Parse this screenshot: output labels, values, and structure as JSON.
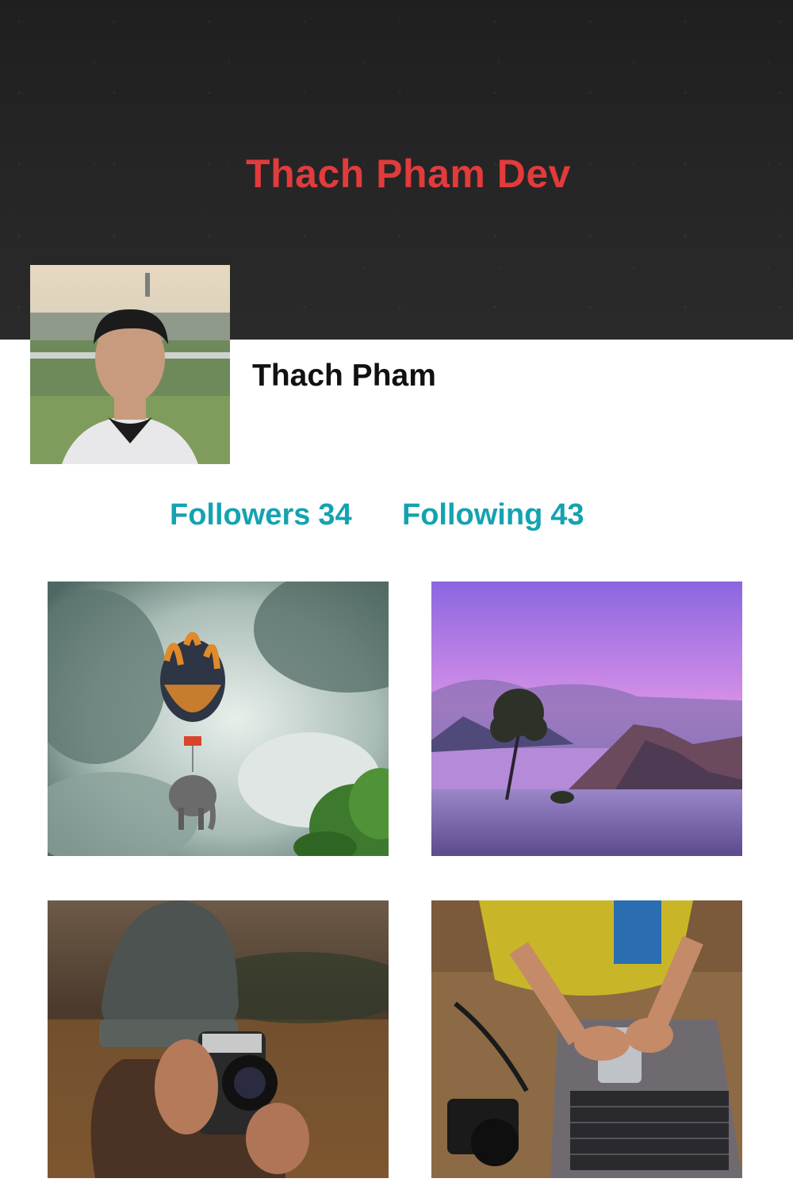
{
  "header": {
    "site_title": "Thach Pham Dev",
    "background_color": "#1f1f20",
    "title_color": "#e23b3b"
  },
  "profile": {
    "name": "Thach Pham",
    "avatar_icon": "person-photo"
  },
  "stats": {
    "followers_label": "Followers",
    "followers_count": "34",
    "following_label": "Following",
    "following_count": "43",
    "color": "#14a3b0"
  },
  "gallery": {
    "photos": [
      {
        "subject": "balloon-elephant-photo"
      },
      {
        "subject": "lake-tree-mountains-photo"
      },
      {
        "subject": "person-camera-beanie-photo"
      },
      {
        "subject": "hands-phone-laptop-photo"
      }
    ]
  }
}
